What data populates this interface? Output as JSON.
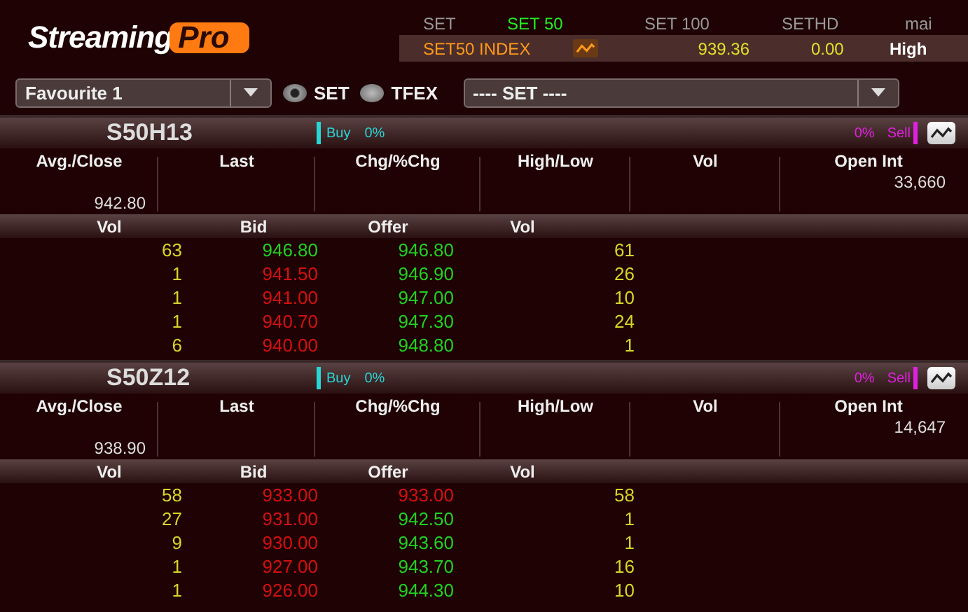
{
  "logo": {
    "text": "Streaming",
    "badge": "Pro"
  },
  "index_tabs": [
    {
      "label": "SET",
      "selected": false
    },
    {
      "label": "SET 50",
      "selected": true
    },
    {
      "label": "SET 100",
      "selected": false
    },
    {
      "label": "SETHD",
      "selected": false
    },
    {
      "label": "mai",
      "selected": false
    }
  ],
  "index_bar": {
    "name": "SET50 INDEX",
    "value": "939.36",
    "change": "0.00",
    "level_label": "High"
  },
  "favourite_dropdown": {
    "value": "Favourite 1"
  },
  "market_radios": [
    {
      "label": "SET",
      "selected": true
    },
    {
      "label": "TFEX",
      "selected": false
    }
  ],
  "market_dropdown": {
    "value": "---- SET ----"
  },
  "panels": [
    {
      "symbol": "S50H13",
      "buy_label": "Buy",
      "buy_pct": "0%",
      "sell_pct": "0%",
      "sell_label": "Sell",
      "columns": [
        "Avg./Close",
        "Last",
        "Chg/%Chg",
        "High/Low",
        "Vol",
        "Open Int"
      ],
      "avg_close": "942.80",
      "open_int": "33,660",
      "depth_columns": [
        "Vol",
        "Bid",
        "Offer",
        "Vol"
      ],
      "depth": [
        {
          "bid_vol": "63",
          "bid": {
            "text": "946.80",
            "color": "#22d022"
          },
          "offer": {
            "text": "946.80",
            "color": "#22d022"
          },
          "offer_vol": "61"
        },
        {
          "bid_vol": "1",
          "bid": {
            "text": "941.50",
            "color": "#d41010"
          },
          "offer": {
            "text": "946.90",
            "color": "#22d022"
          },
          "offer_vol": "26"
        },
        {
          "bid_vol": "1",
          "bid": {
            "text": "941.00",
            "color": "#d41010"
          },
          "offer": {
            "text": "947.00",
            "color": "#22d022"
          },
          "offer_vol": "10"
        },
        {
          "bid_vol": "1",
          "bid": {
            "text": "940.70",
            "color": "#d41010"
          },
          "offer": {
            "text": "947.30",
            "color": "#22d022"
          },
          "offer_vol": "24"
        },
        {
          "bid_vol": "6",
          "bid": {
            "text": "940.00",
            "color": "#d41010"
          },
          "offer": {
            "text": "948.80",
            "color": "#22d022"
          },
          "offer_vol": "1"
        }
      ]
    },
    {
      "symbol": "S50Z12",
      "buy_label": "Buy",
      "buy_pct": "0%",
      "sell_pct": "0%",
      "sell_label": "Sell",
      "columns": [
        "Avg./Close",
        "Last",
        "Chg/%Chg",
        "High/Low",
        "Vol",
        "Open Int"
      ],
      "avg_close": "938.90",
      "open_int": "14,647",
      "depth_columns": [
        "Vol",
        "Bid",
        "Offer",
        "Vol"
      ],
      "depth": [
        {
          "bid_vol": "58",
          "bid": {
            "text": "933.00",
            "color": "#d41010"
          },
          "offer": {
            "text": "933.00",
            "color": "#d41010"
          },
          "offer_vol": "58"
        },
        {
          "bid_vol": "27",
          "bid": {
            "text": "931.00",
            "color": "#d41010"
          },
          "offer": {
            "text": "942.50",
            "color": "#22d022"
          },
          "offer_vol": "1"
        },
        {
          "bid_vol": "9",
          "bid": {
            "text": "930.00",
            "color": "#d41010"
          },
          "offer": {
            "text": "943.60",
            "color": "#22d022"
          },
          "offer_vol": "1"
        },
        {
          "bid_vol": "1",
          "bid": {
            "text": "927.00",
            "color": "#d41010"
          },
          "offer": {
            "text": "943.70",
            "color": "#22d022"
          },
          "offer_vol": "16"
        },
        {
          "bid_vol": "1",
          "bid": {
            "text": "926.00",
            "color": "#d41010"
          },
          "offer": {
            "text": "944.30",
            "color": "#22d022"
          },
          "offer_vol": "10"
        }
      ]
    }
  ]
}
